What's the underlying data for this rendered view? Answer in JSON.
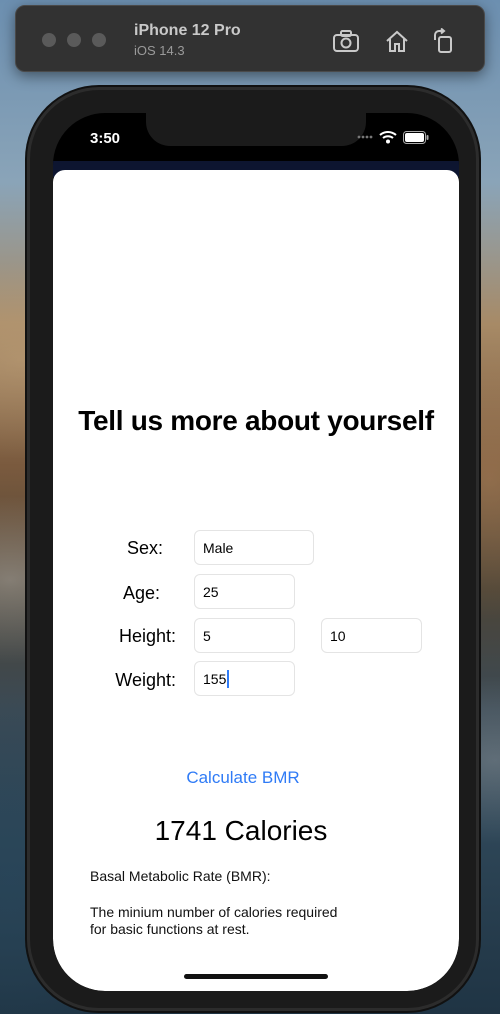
{
  "simulator": {
    "device_name": "iPhone 12 Pro",
    "os_version": "iOS 14.3",
    "buttons": [
      "screenshot-icon",
      "home-icon",
      "rotate-icon"
    ]
  },
  "status_bar": {
    "time": "3:50",
    "icons": [
      "cellular-icon",
      "wifi-icon",
      "battery-icon"
    ]
  },
  "form": {
    "heading": "Tell us more about yourself",
    "sex_label": "Sex:",
    "sex_value": "Male",
    "age_label": "Age:",
    "age_value": "25",
    "height_label": "Height:",
    "height_feet_value": "5",
    "height_inches_value": "10",
    "weight_label": "Weight:",
    "weight_value": "155",
    "calculate_label": "Calculate BMR"
  },
  "result": {
    "calories": "1741 Calories",
    "bmr_title": "Basal Metabolic Rate (BMR):",
    "description_line1": "The minium number of calories required",
    "description_line2": "for basic functions at rest."
  },
  "colors": {
    "accent": "#2f7bf6",
    "window_bar": "#323232"
  }
}
